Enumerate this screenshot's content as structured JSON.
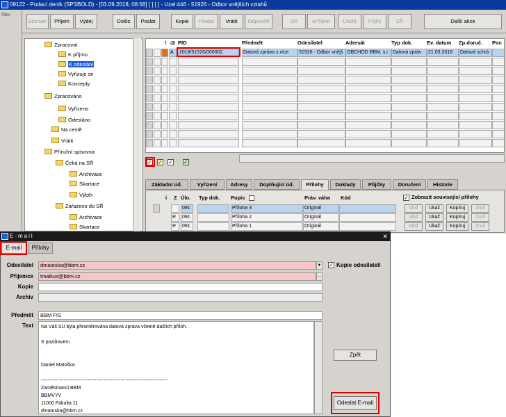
{
  "main_window": {
    "title": "09122 - Podací deník (SPSBOLD) - [03.09.2018; 08:58] [ ] [ ] - Uzel:446 - 51926 - Odbor vnějších vztahů",
    "left_strip_label": "Nav"
  },
  "toolbar": {
    "buttons": [
      {
        "label": "Seznam",
        "enabled": false
      },
      {
        "label": "Příjem",
        "enabled": true
      },
      {
        "label": "Výdej",
        "enabled": true
      },
      {
        "label": "Došlo",
        "enabled": true
      },
      {
        "label": "Poslat",
        "enabled": true
      },
      {
        "label": "Kopie",
        "enabled": true
      },
      {
        "label": "Předat",
        "enabled": false
      },
      {
        "label": "Vrátit",
        "enabled": true
      },
      {
        "label": "Odpověď",
        "enabled": false
      },
      {
        "label": "OK",
        "enabled": false
      },
      {
        "label": "ePříjem",
        "enabled": false
      },
      {
        "label": "Uložit",
        "enabled": false
      },
      {
        "label": "Půjčit",
        "enabled": false
      },
      {
        "label": "SŘ",
        "enabled": false
      },
      {
        "label": "Další akce",
        "enabled": true
      }
    ]
  },
  "tree": {
    "items": [
      {
        "label": "Zpracovat",
        "level": 0,
        "selected": false
      },
      {
        "label": "K příjmu",
        "level": 1,
        "selected": false
      },
      {
        "label": "K odeslání",
        "level": 1,
        "selected": true
      },
      {
        "label": "Vyřizuje se",
        "level": 1,
        "selected": false
      },
      {
        "label": "Koncepty",
        "level": 1,
        "selected": false
      },
      {
        "label": "Zpracováno",
        "level": 0,
        "selected": false
      },
      {
        "label": "Vyřízeno",
        "level": 1,
        "selected": false
      },
      {
        "label": "Odesláno",
        "level": 1,
        "selected": false
      },
      {
        "label": "Na cestě",
        "level": 0,
        "selected": false
      },
      {
        "label": "Vrátit",
        "level": 0,
        "selected": false
      },
      {
        "label": "Příruční spisovna",
        "level": 0,
        "selected": false
      },
      {
        "label": "Čeká na SŘ",
        "level": 1,
        "selected": false
      },
      {
        "label": "Archivace",
        "level": 2,
        "selected": false
      },
      {
        "label": "Skartace",
        "level": 2,
        "selected": false
      },
      {
        "label": "Výběr",
        "level": 2,
        "selected": false
      },
      {
        "label": "Zařazeno do SŘ",
        "level": 1,
        "selected": false
      },
      {
        "label": "Archivace",
        "level": 2,
        "selected": false
      },
      {
        "label": "Skartace",
        "level": 2,
        "selected": false
      }
    ]
  },
  "grid": {
    "headers": [
      "!",
      "@",
      "PID",
      "Předmět",
      "Odesílatel",
      "Adresát",
      "Typ dok.",
      "Ev. datum",
      "Zp.doruč.",
      "Poc"
    ],
    "rows": [
      [
        "",
        "A",
        "2018/51926/000002",
        "Datová zpráva s více",
        "51926 - Odbor vnějš",
        "OBCHOD BBM, s.r",
        "Datová zpráv",
        "21.03.2018",
        "Datová schrá",
        ""
      ]
    ]
  },
  "tabs": {
    "items": [
      "Základní úd.",
      "Vyřízení",
      "Adresy",
      "Doplňující úd.",
      "Přílohy",
      "Doklady",
      "Půjčky",
      "Doručení",
      "Historie"
    ],
    "active": "Přílohy"
  },
  "attachments": {
    "headers": [
      "i",
      "Z",
      "Úlo.",
      "Typ dok.",
      "Popis",
      "Práv. váha",
      "Kód"
    ],
    "rows": [
      {
        "z": "",
        "ulo": "091",
        "typ": "",
        "popis": "Příloha 3",
        "vaha": "Originál",
        "kod": ""
      },
      {
        "z": "R",
        "ulo": "091",
        "typ": "",
        "popis": "Příloha 2",
        "vaha": "Originál",
        "kod": ""
      },
      {
        "z": "R",
        "ulo": "091",
        "typ": "",
        "popis": "Příloha 1",
        "vaha": "Originál",
        "kod": ""
      }
    ],
    "show_related_label": "Zobrazit související přílohy",
    "buttons": [
      {
        "label": "Vlož",
        "enabled": false
      },
      {
        "label": "Ukaž",
        "enabled": true
      },
      {
        "label": "Kopíruj",
        "enabled": true
      },
      {
        "label": "Zruš",
        "enabled": false
      }
    ]
  },
  "email": {
    "title": "E-mail",
    "tabs": [
      "E-mail",
      "Přílohy"
    ],
    "fields": {
      "sender_label": "Odesílatel",
      "sender_value": "dmatoska@bbm.cz",
      "recipient_label": "Příjemce",
      "recipient_value": "tmalkus@bbm.cz",
      "copy_label": "Kopie",
      "copy_value": "",
      "archive_label": "Archiv",
      "archive_value": "",
      "subject_label": "Předmět",
      "subject_value": "BBM FIS",
      "text_label": "Text"
    },
    "copy_sender_label": "Kopie odesílateli",
    "body_lines": [
      "Na Váš SU byla přesměrována datová zpráva včetně dalších příloh.",
      "",
      "S pozdravem",
      "",
      "",
      "Daniel Matoška",
      "",
      "------------------------------------------------------------------------------",
      "Zaměstnanci BBM",
      "BBMVYV",
      "11000 Fakulta 11",
      "dmatoska@bbm.cz"
    ],
    "back_button": "Zpět",
    "send_button": "Odeslat E-mail"
  },
  "colors": {
    "highlight_red": "#e00000",
    "selection_blue": "#1e5cd8",
    "required_pink": "#f6c6c6"
  }
}
